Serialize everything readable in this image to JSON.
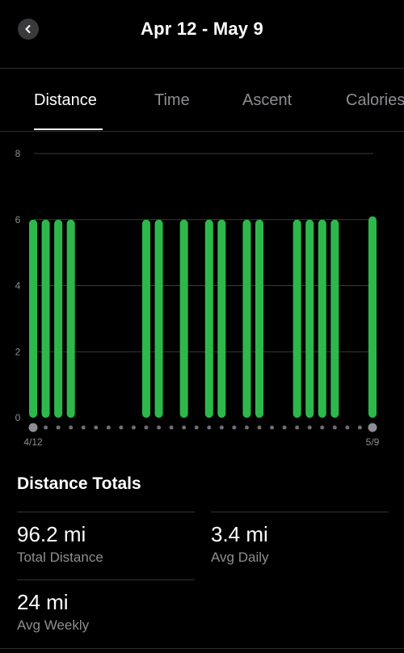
{
  "header": {
    "title": "Apr 12 - May 9",
    "back_icon": "chevron-left-icon"
  },
  "tabs": [
    {
      "label": "Distance",
      "active": true
    },
    {
      "label": "Time",
      "active": false
    },
    {
      "label": "Ascent",
      "active": false
    },
    {
      "label": "Calories",
      "active": false
    }
  ],
  "colors": {
    "accent": "#2db84b",
    "background": "#000000",
    "muted": "#8e8e93"
  },
  "chart_data": {
    "type": "bar",
    "x": [
      "4/12",
      "4/13",
      "4/14",
      "4/15",
      "4/16",
      "4/17",
      "4/18",
      "4/19",
      "4/20",
      "4/21",
      "4/22",
      "4/23",
      "4/24",
      "4/25",
      "4/26",
      "4/27",
      "4/28",
      "4/29",
      "4/30",
      "5/1",
      "5/2",
      "5/3",
      "5/4",
      "5/5",
      "5/6",
      "5/7",
      "5/8",
      "5/9"
    ],
    "values": [
      6,
      6,
      6,
      6,
      0,
      0,
      0,
      0,
      0,
      6,
      6,
      0,
      6,
      0,
      6,
      6,
      0,
      6,
      6,
      0,
      0,
      6,
      6,
      6,
      6,
      0,
      0,
      6.1
    ],
    "x_tick_labels": [
      "4/12",
      "5/9"
    ],
    "yticks": [
      0,
      2,
      4,
      6,
      8
    ],
    "ylim": [
      0,
      8
    ],
    "grid": true,
    "highlighted_dates": [
      "4/12",
      "5/9"
    ],
    "title": "",
    "xlabel": "",
    "ylabel": ""
  },
  "totals": {
    "title": "Distance Totals",
    "stats": [
      {
        "value": "96.2 mi",
        "label": "Total Distance"
      },
      {
        "value": "3.4 mi",
        "label": "Avg Daily"
      },
      {
        "value": "24 mi",
        "label": "Avg Weekly"
      }
    ]
  }
}
